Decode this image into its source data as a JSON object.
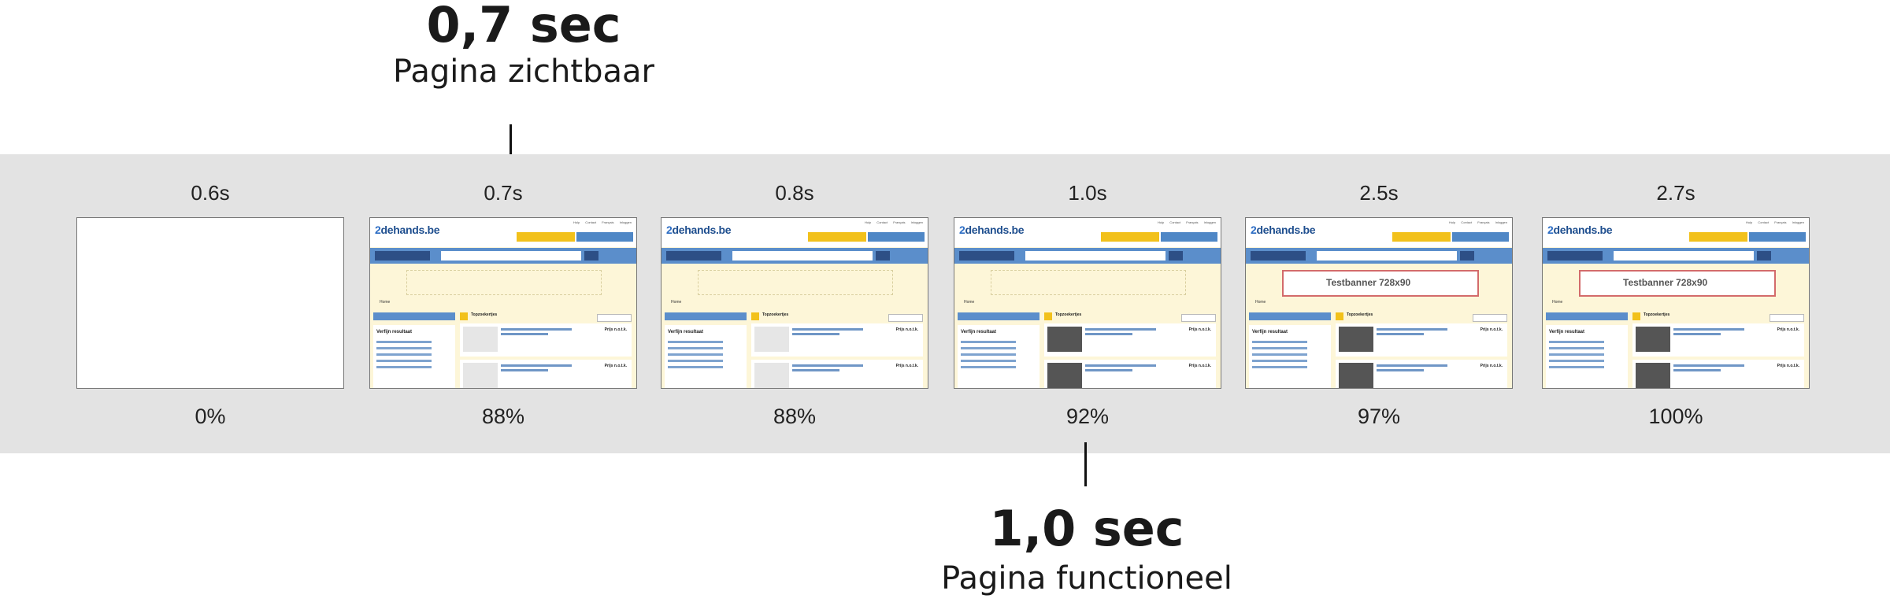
{
  "annotations": {
    "visible": {
      "time": "0,7 sec",
      "label": "Pagina zichtbaar"
    },
    "functional": {
      "time": "1,0 sec",
      "label": "Pagina functioneel"
    }
  },
  "filmstrip": {
    "frames": [
      {
        "time": "0.6s",
        "percent": "0%"
      },
      {
        "time": "0.7s",
        "percent": "88%"
      },
      {
        "time": "0.8s",
        "percent": "88%"
      },
      {
        "time": "1.0s",
        "percent": "92%"
      },
      {
        "time": "2.5s",
        "percent": "97%"
      },
      {
        "time": "2.7s",
        "percent": "100%"
      }
    ]
  },
  "thumbnail_page": {
    "logo_prefix": "2",
    "logo_rest": "dehands.be",
    "top_links": "Hulp Contact Français Inloggen",
    "home": "Home",
    "sidebar_heading": "Verfijn resultaat",
    "top_section": "Topzoekertjes",
    "price": "Prijs n.o.t.k.",
    "banner": "Testbanner 728x90"
  },
  "colors": {
    "band": "#e3e3e3",
    "brand_blue": "#5b8ecb",
    "brand_yellow": "#f2c11b",
    "page_bg": "#fdf6d8"
  }
}
